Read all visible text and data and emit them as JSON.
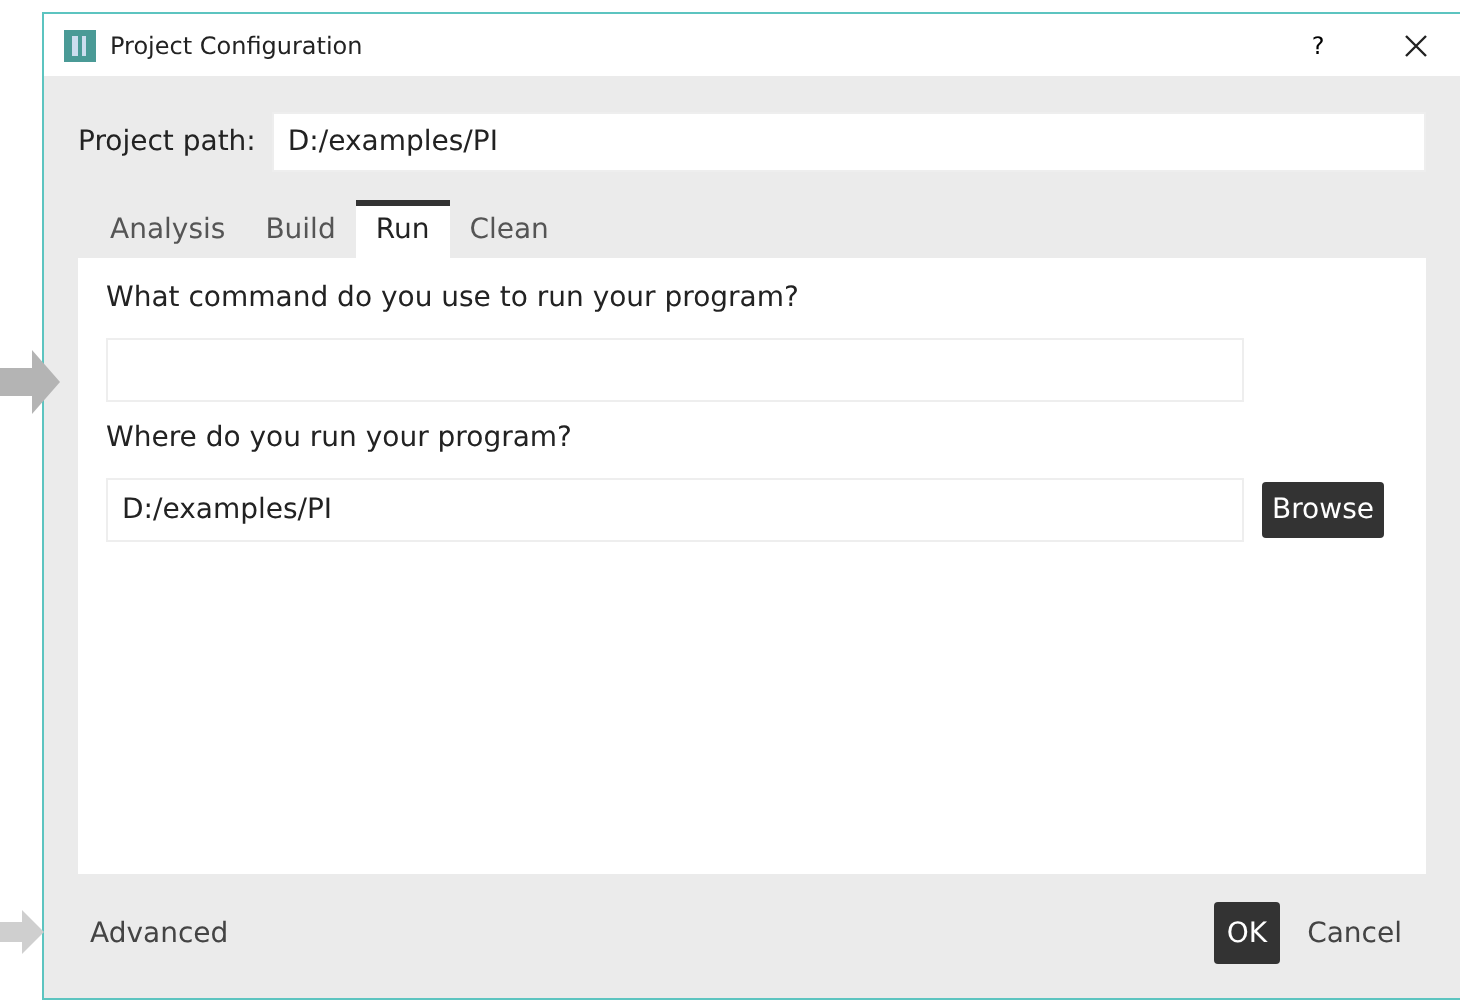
{
  "window": {
    "title": "Project Configuration",
    "help": "?"
  },
  "project_path": {
    "label": "Project path:",
    "value": "D:/examples/PI"
  },
  "tabs": [
    {
      "label": "Analysis",
      "selected": false
    },
    {
      "label": "Build",
      "selected": false
    },
    {
      "label": "Run",
      "selected": true
    },
    {
      "label": "Clean",
      "selected": false
    }
  ],
  "run_panel": {
    "fields": [
      {
        "label": "What command do you use to run your program?"
      },
      {
        "label": "Where do you run your program?",
        "value": "D:/examples/PI",
        "button": "Browse"
      }
    ]
  },
  "footer": {
    "link": "Advanced",
    "buttons": [
      {
        "label": "OK",
        "kind": "primary"
      },
      {
        "label": "Cancel",
        "kind": "plain"
      }
    ]
  }
}
